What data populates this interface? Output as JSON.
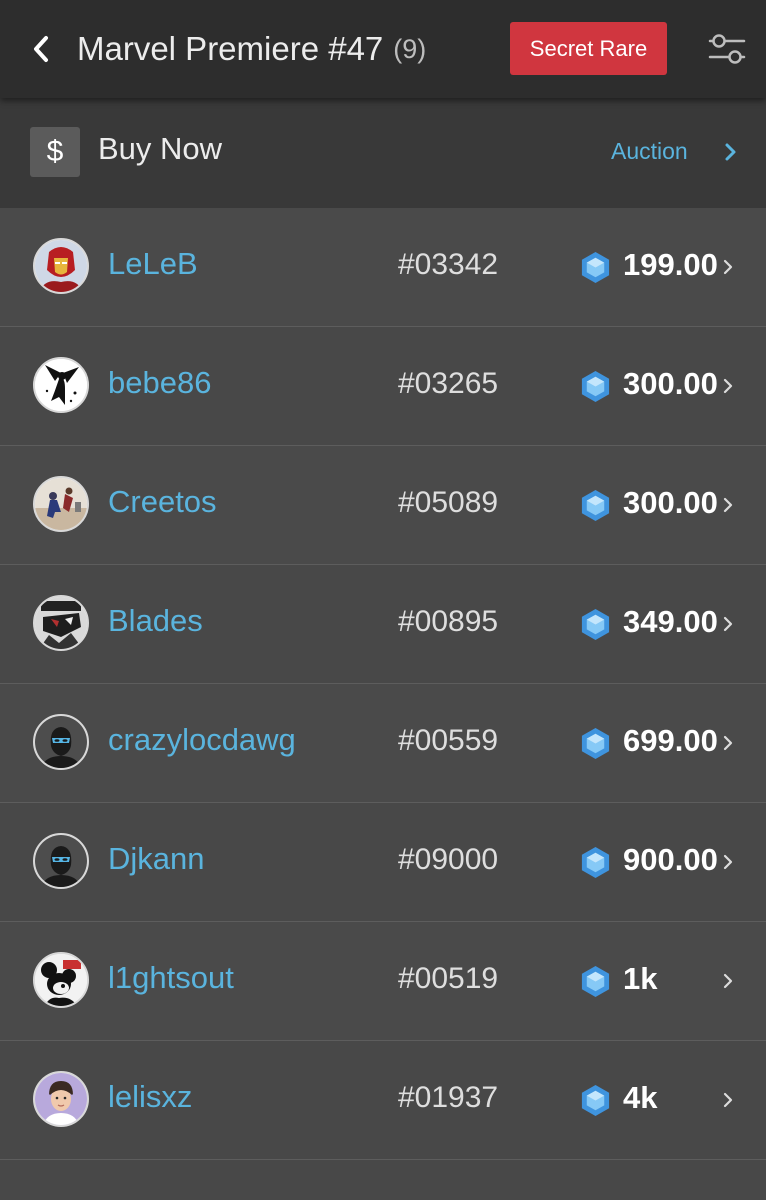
{
  "header": {
    "back_icon": "chevron-left-icon",
    "title": "Marvel Premiere #47",
    "count": "(9)",
    "rarity_label": "Secret Rare",
    "filter_icon": "sliders-icon"
  },
  "subbar": {
    "currency_symbol": "$",
    "buy_label": "Buy Now",
    "auction_label": "Auction",
    "auction_icon": "chevron-right-icon"
  },
  "listings": [
    {
      "username": "LeLeB",
      "serial": "#03342",
      "price": "199.00",
      "avatar": "iron-man-avatar"
    },
    {
      "username": "bebe86",
      "serial": "#03265",
      "price": "300.00",
      "avatar": "fairy-silhouette-avatar"
    },
    {
      "username": "Creetos",
      "serial": "#05089",
      "price": "300.00",
      "avatar": "action-scene-avatar"
    },
    {
      "username": "Blades",
      "serial": "#00895",
      "price": "349.00",
      "avatar": "comic-character-avatar"
    },
    {
      "username": "crazylocdawg",
      "serial": "#00559",
      "price": "699.00",
      "avatar": "masked-default-avatar"
    },
    {
      "username": "Djkann",
      "serial": "#09000",
      "price": "900.00",
      "avatar": "masked-default-avatar"
    },
    {
      "username": "l1ghtsout",
      "serial": "#00519",
      "price": "1k",
      "avatar": "cartoon-mouse-avatar"
    },
    {
      "username": "lelisxz",
      "serial": "#01937",
      "price": "4k",
      "avatar": "portrait-avatar"
    }
  ],
  "colors": {
    "header_bg": "#2d2d2d",
    "subbar_bg": "#393939",
    "list_bg": "#4a4a4a",
    "accent_blue": "#5ab4de",
    "rarity_red": "#d0363f",
    "gem_blue": "#4aa3e8"
  }
}
